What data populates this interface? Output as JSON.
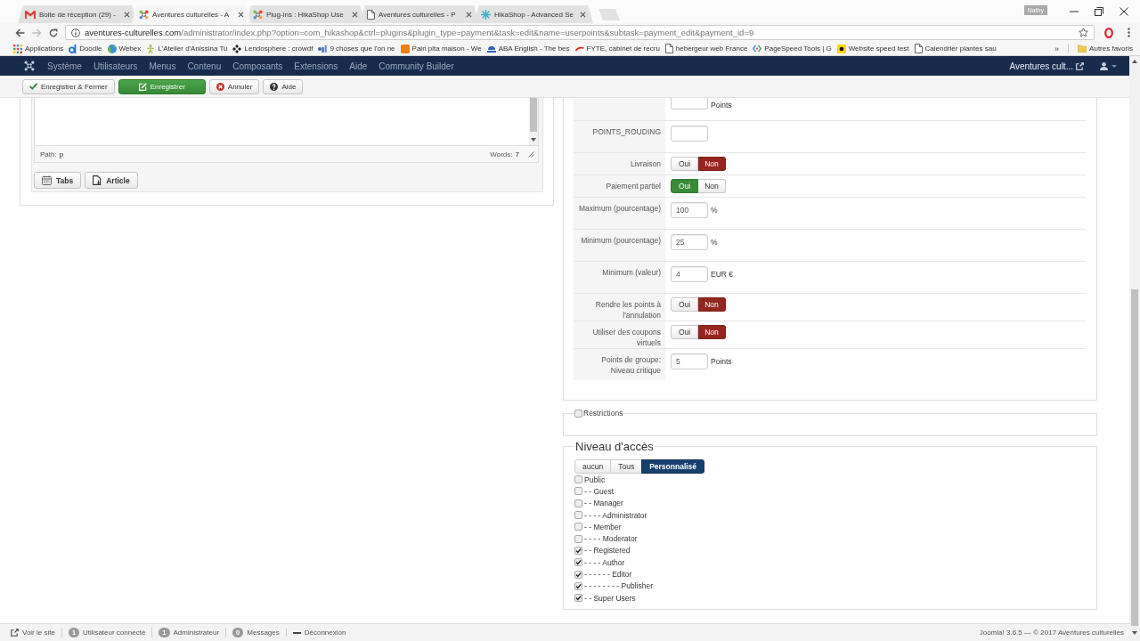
{
  "browser": {
    "tabs": [
      {
        "title": "Boite de réception (29) -",
        "kind": "envelope",
        "selected": false
      },
      {
        "title": "Aventures culturelles - A",
        "kind": "knot",
        "selected": true
      },
      {
        "title": "Plug-ins : HikaShop Use",
        "kind": "knot",
        "selected": false
      },
      {
        "title": "Aventures culturelles - P",
        "kind": "page",
        "selected": false
      },
      {
        "title": "HikaShop - Advanced Se",
        "kind": "asterisk",
        "selected": false
      }
    ],
    "profile": "Nathy",
    "address": {
      "host": "aventures-culturelles.com",
      "path": "/administrator/index.php?option=com_hikashop&ctrl=plugins&plugin_type=payment&task=edit&name=userpoints&subtask=payment_edit&payment_id=9"
    },
    "bookmarks": [
      {
        "label": "Applications",
        "kind": "grid"
      },
      {
        "label": "Doodle",
        "kind": "d"
      },
      {
        "label": "Webex",
        "kind": "globe"
      },
      {
        "label": "L'Atelier d'Anissina Tu",
        "kind": "figure"
      },
      {
        "label": "Lendosphere : crowdf",
        "kind": "diamond"
      },
      {
        "label": "9 choses que l'on ne",
        "kind": "logo"
      },
      {
        "label": "Pain pita maison - We",
        "kind": "tile"
      },
      {
        "label": "ABA English - The bes",
        "kind": "dome"
      },
      {
        "label": "FYTE, cabinet de recru",
        "kind": "swoosh"
      },
      {
        "label": "hebergeur web France",
        "kind": "page"
      },
      {
        "label": "PageSpeed Tools | G",
        "kind": "brackets"
      },
      {
        "label": "Website speed test",
        "kind": "square"
      },
      {
        "label": "Calendrier plantes sau",
        "kind": "page"
      }
    ],
    "more": "»",
    "other_bookmarks": "Autres favoris"
  },
  "admin_menu": {
    "items": [
      "Système",
      "Utilisateurs",
      "Menus",
      "Contenu",
      "Composants",
      "Extensions",
      "Aide",
      "Community Builder"
    ],
    "site": "Aventures cult..."
  },
  "toolbar": [
    {
      "label": "Enregistrer & Fermer",
      "kind": "close"
    },
    {
      "label": "Enregistrer",
      "kind": "save"
    },
    {
      "label": "Annuler",
      "kind": "cancel"
    },
    {
      "label": "Aide",
      "kind": "help"
    }
  ],
  "editor": {
    "path_label": "Path:",
    "path_value": "p",
    "words_label": "Words:",
    "words_value": "7",
    "buttons": [
      {
        "label": "Tabs",
        "kind": "tabs"
      },
      {
        "label": "Article",
        "kind": "article"
      }
    ]
  },
  "settings": [
    {
      "kind": "stub",
      "unit": "Points"
    },
    {
      "kind": "field",
      "label": "POINTS_ROUDING"
    },
    {
      "kind": "toggle",
      "label": "Livraison",
      "options": [
        {
          "label": "Oui",
          "selected": false
        },
        {
          "label": "Non",
          "selected": true
        }
      ]
    },
    {
      "kind": "toggle",
      "label": "Paiement partiel",
      "options": [
        {
          "label": "Oui",
          "selected": true
        },
        {
          "label": "Non",
          "selected": false
        }
      ]
    },
    {
      "kind": "field",
      "label": "Maximum (pourcentage)",
      "value": "100",
      "unit": "%"
    },
    {
      "kind": "field",
      "label": "Minimum (pourcentage)",
      "value": "25",
      "unit": "%"
    },
    {
      "kind": "field",
      "label": "Minimum (valeur)",
      "value": "4",
      "unit": "EUR €"
    },
    {
      "kind": "toggle",
      "label": "Rendre les points à l'annulation",
      "options": [
        {
          "label": "Oui",
          "selected": false
        },
        {
          "label": "Non",
          "selected": true
        }
      ]
    },
    {
      "kind": "toggle",
      "label": "Utiliser des coupons virtuels",
      "options": [
        {
          "label": "Oui",
          "selected": false
        },
        {
          "label": "Non",
          "selected": true
        }
      ]
    },
    {
      "kind": "field",
      "label": "Points de groupe: Niveau critique",
      "value": "5",
      "unit": "Points"
    }
  ],
  "restrictions": {
    "label": "Restrictions",
    "checked": false
  },
  "access": {
    "title": "Niveau d'accès",
    "modes": [
      {
        "label": "aucun",
        "selected": false
      },
      {
        "label": "Tous",
        "selected": false
      },
      {
        "label": "Personnalisé",
        "selected": true
      }
    ],
    "groups": [
      {
        "label": "Public",
        "checked": false
      },
      {
        "label": "- - Guest",
        "checked": false
      },
      {
        "label": "- - Manager",
        "checked": false
      },
      {
        "label": "- - - - Administrator",
        "checked": false
      },
      {
        "label": "- - Member",
        "checked": false
      },
      {
        "label": "- - - - Moderator",
        "checked": false
      },
      {
        "label": "- - Registered",
        "checked": true
      },
      {
        "label": "- - - - Author",
        "checked": true
      },
      {
        "label": "- - - - - - Editor",
        "checked": true
      },
      {
        "label": "- - - - - - - - Publisher",
        "checked": true
      },
      {
        "label": "- - Super Users",
        "checked": true
      }
    ]
  },
  "status_bar": {
    "items": [
      {
        "kind": "link",
        "label": "Voir le site"
      },
      {
        "kind": "count",
        "count": "1",
        "label": "Utilisateur connecté"
      },
      {
        "kind": "count",
        "count": "1",
        "label": "Administrateur"
      },
      {
        "kind": "count",
        "count": "0",
        "label": "Messages"
      },
      {
        "kind": "logout",
        "label": "Déconnexion"
      }
    ],
    "copyright": "Joomla! 3.6.5 — © 2017 Aventures culturelles"
  }
}
